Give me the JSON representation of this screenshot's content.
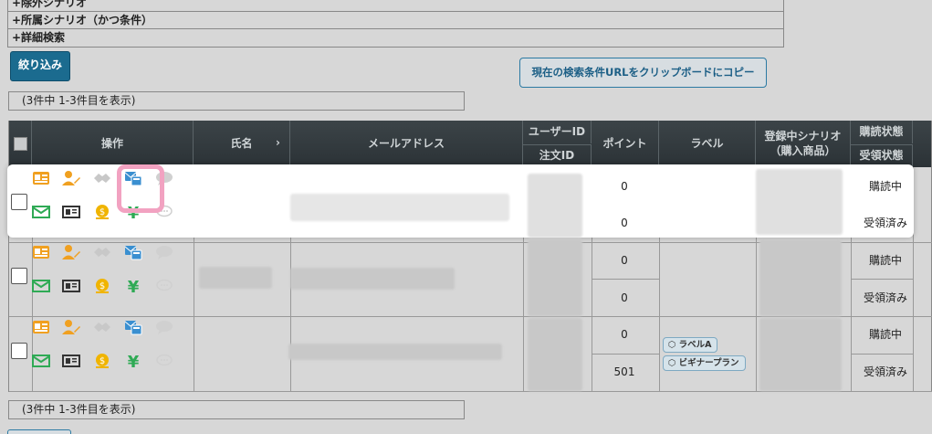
{
  "filters": {
    "row1": "+除外シナリオ",
    "row2": "+所属シナリオ（かつ条件）",
    "row3": "+詳細検索"
  },
  "buttons": {
    "filter": "絞り込み",
    "copy_url": "現在の検索条件URLをクリップボードにコピー"
  },
  "result_count": "(3件中 1-3件目を表示)",
  "table": {
    "headers": {
      "operation": "操作",
      "name": "氏名",
      "email": "メールアドレス",
      "user_id": "ユーザーID",
      "order_id": "注文ID",
      "points": "ポイント",
      "label": "ラベル",
      "scenario": "登録中シナリオ\n（購入商品）",
      "subscribe_status": "購読状態",
      "receive_status": "受領状態"
    },
    "rows": [
      {
        "points_top": "0",
        "points_bottom": "0",
        "status_top": "購読中",
        "status_bottom": "受領済み",
        "labels": []
      },
      {
        "points_top": "0",
        "points_bottom": "0",
        "status_top": "購読中",
        "status_bottom": "受領済み",
        "labels": []
      },
      {
        "points_top": "0",
        "points_bottom": "501",
        "status_top": "購読中",
        "status_bottom": "受領済み",
        "labels": [
          "ラベルA",
          "ビギナープラン"
        ]
      }
    ]
  },
  "icons": {
    "id_card": "id-card-icon",
    "user_edit": "user-edit-icon",
    "handshake": "handshake-icon",
    "mail_card": "mail-card-icon",
    "chat": "chat-icon",
    "mail": "mail-icon",
    "news": "newspaper-icon",
    "money": "money-bag-icon",
    "yen": "yen-icon",
    "chat_outline": "chat-outline-icon"
  },
  "colors": {
    "header_bg": "#2f373b",
    "primary": "#1b6b8f",
    "orange": "#f0a020",
    "green": "#2faa55",
    "blue": "#3a8fd0",
    "highlight_ring": "#f2a2c1"
  }
}
